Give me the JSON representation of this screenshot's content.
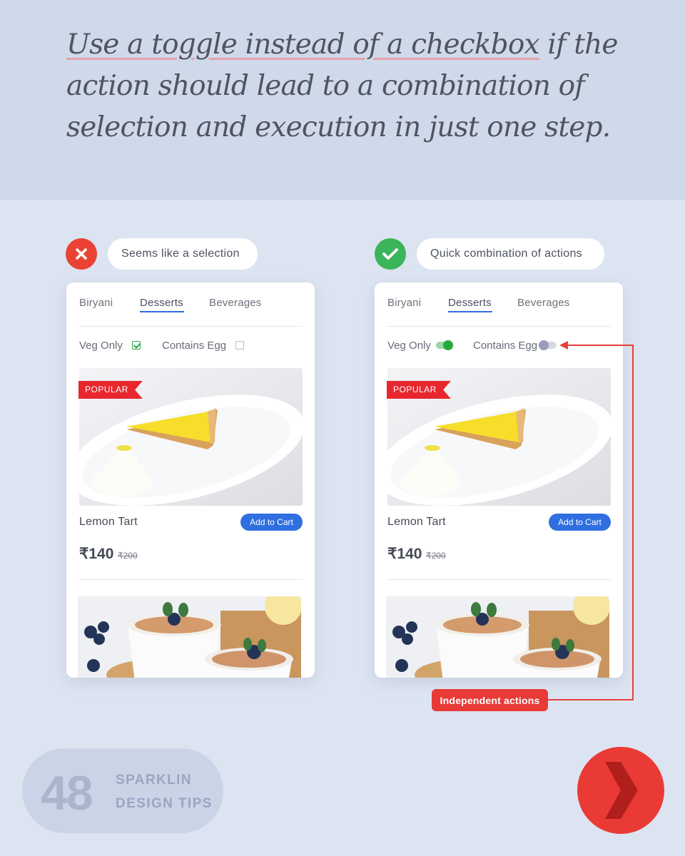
{
  "headline": {
    "highlight": "Use a toggle instead of a checkbox",
    "rest": " if the action should lead to a combination of selection and execution in just one step."
  },
  "colors": {
    "accent_blue": "#2f6fe0",
    "bad_red": "#ea4335",
    "good_green": "#3bb55a",
    "callout_red": "#e83a37"
  },
  "left": {
    "verdict_icon": "x-icon",
    "label": "Seems like a selection",
    "tabs": [
      "Biryani",
      "Desserts",
      "Beverages"
    ],
    "active_tab": "Desserts",
    "filters": {
      "veg_only": {
        "label": "Veg Only",
        "control": "checkbox",
        "checked": true
      },
      "contains_egg": {
        "label": "Contains Egg",
        "control": "checkbox",
        "checked": false
      }
    },
    "item": {
      "badge": "POPULAR",
      "name": "Lemon Tart",
      "button": "Add to Cart",
      "price": "₹140",
      "old_price": "₹200"
    }
  },
  "right": {
    "verdict_icon": "check-icon",
    "label": "Quick combination of actions",
    "tabs": [
      "Biryani",
      "Desserts",
      "Beverages"
    ],
    "active_tab": "Desserts",
    "filters": {
      "veg_only": {
        "label": "Veg Only",
        "control": "toggle",
        "on": true
      },
      "contains_egg": {
        "label": "Contains Egg",
        "control": "toggle",
        "on": false
      }
    },
    "item": {
      "badge": "POPULAR",
      "name": "Lemon Tart",
      "button": "Add to Cart",
      "price": "₹140",
      "old_price": "₹200"
    }
  },
  "callout": "Independent actions",
  "footer": {
    "number": "48",
    "line1": "SPARKLIN",
    "line2": "DESIGN TIPS",
    "next_icon": "chevron-right-icon"
  }
}
